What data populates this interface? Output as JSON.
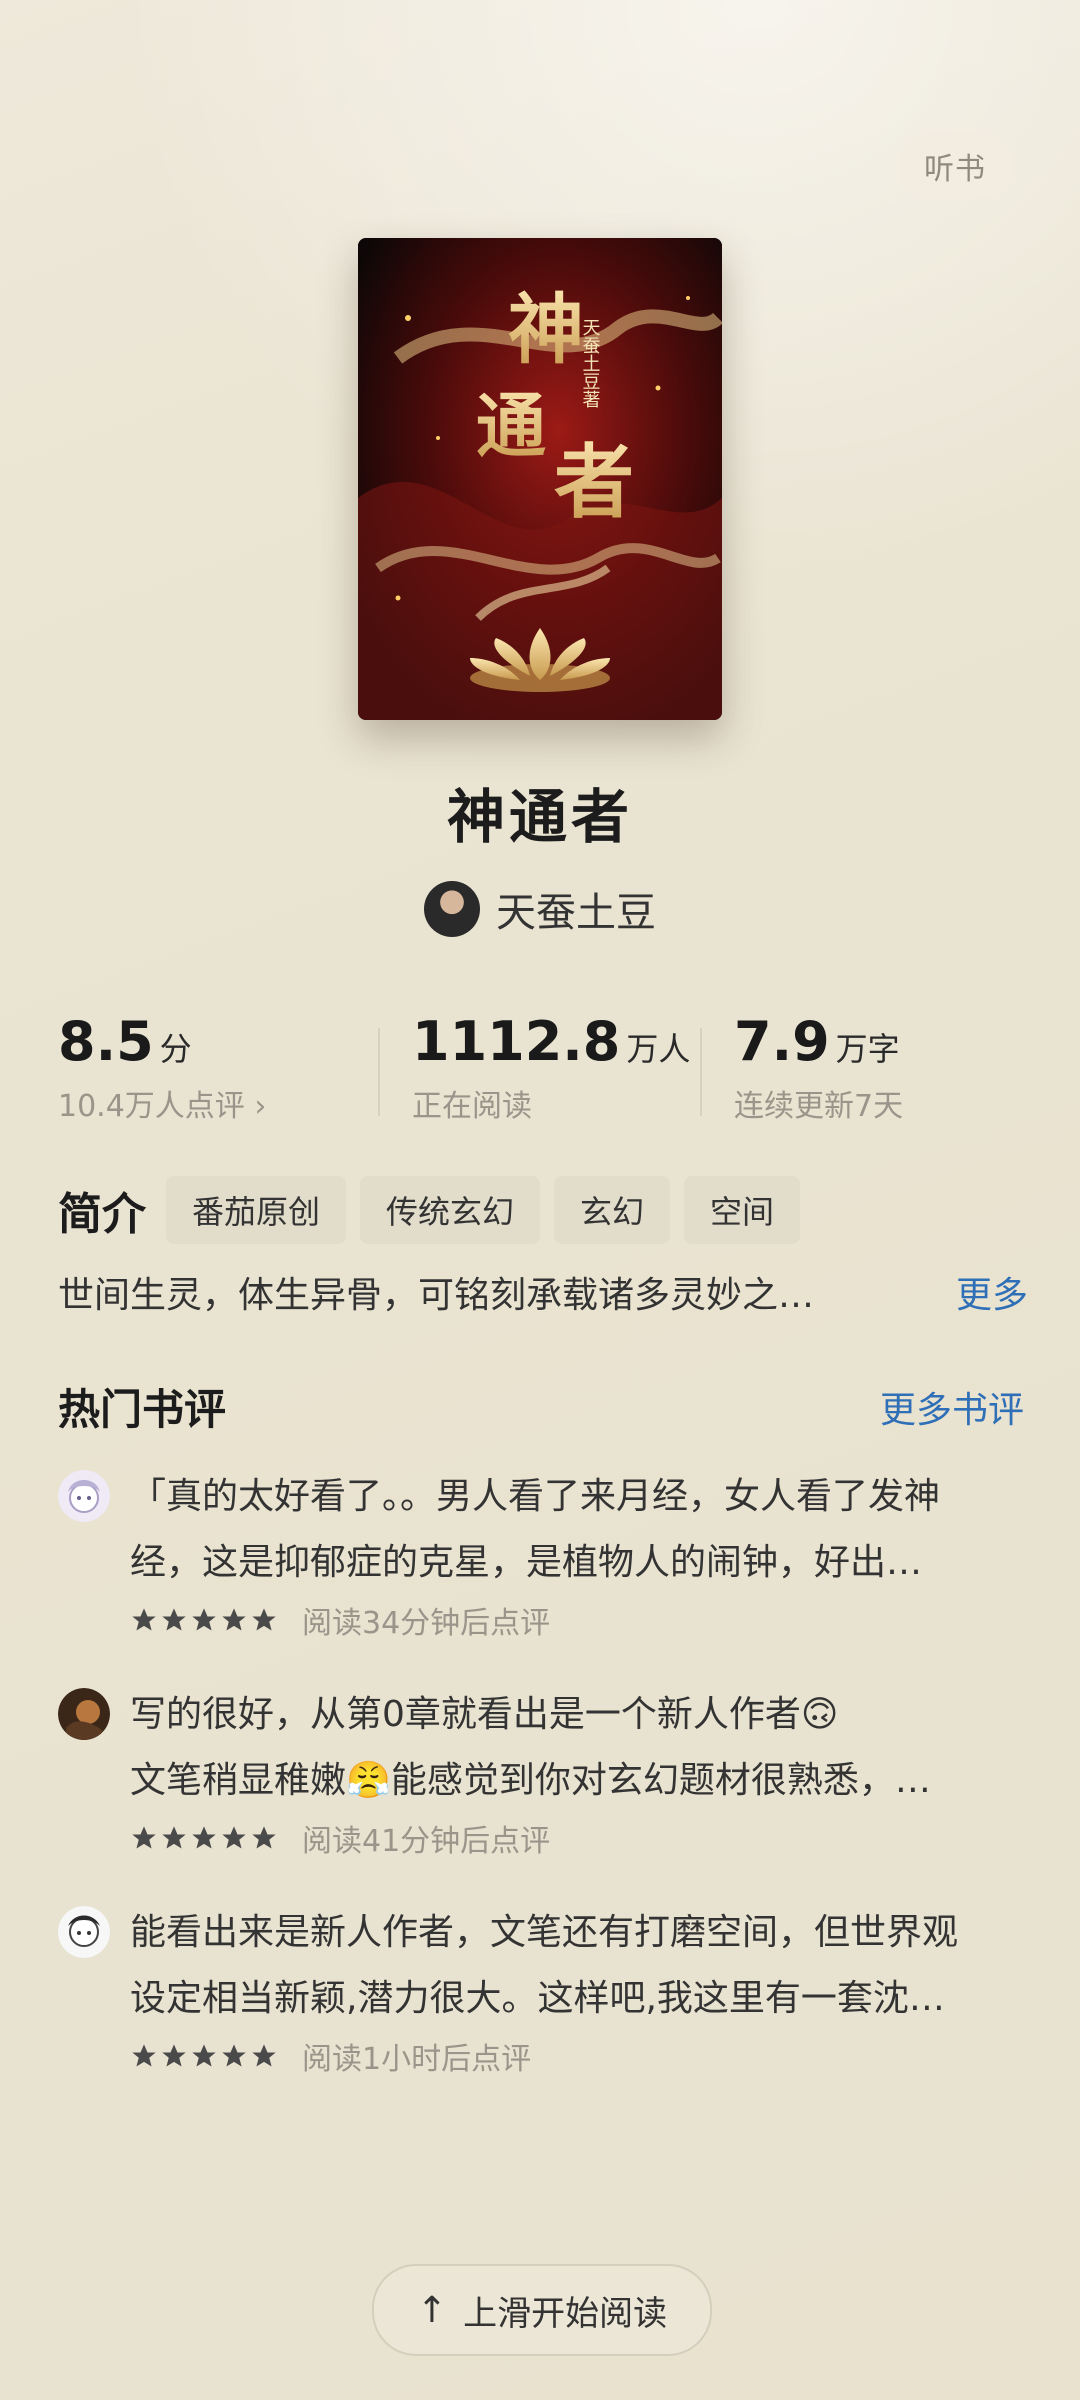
{
  "header": {
    "listen_label": "听书"
  },
  "cover": {
    "title_chars": [
      "神",
      "通",
      "者"
    ],
    "author_seal": "天蚕土豆著"
  },
  "book": {
    "title": "神通者",
    "author": "天蚕土豆"
  },
  "stats": {
    "rating_value": "8.5",
    "rating_unit": "分",
    "rating_sub": "10.4万人点评 ›",
    "readers_value": "1112.8",
    "readers_unit": "万人",
    "readers_sub": "正在阅读",
    "words_value": "7.9",
    "words_unit": "万字",
    "words_sub": "连续更新7天"
  },
  "intro": {
    "label": "简介",
    "tags": [
      "番茄原创",
      "传统玄幻",
      "玄幻",
      "空间"
    ],
    "synopsis": "世间生灵，体生异骨，可铭刻承载诸多灵妙之…",
    "more": "更多"
  },
  "reviews": {
    "title": "热门书评",
    "more": "更多书评",
    "items": [
      {
        "line1": "「真的太好看了。。男人看了来月经，女人看了发神",
        "line2": "经，这是抑郁症的克星，是植物人的闹钟，好出…",
        "stars": 5,
        "meta": "阅读34分钟后点评"
      },
      {
        "line1": "写的很好，从第0章就看出是一个新人作者🙃",
        "line2": "文笔稍显稚嫩😤能感觉到你对玄幻题材很熟悉，…",
        "stars": 5,
        "meta": "阅读41分钟后点评"
      },
      {
        "line1": "能看出来是新人作者，文笔还有打磨空间，但世界观",
        "line2": "设定相当新颖,潜力很大。这样吧,我这里有一套沈…",
        "stars": 5,
        "meta": "阅读1小时后点评"
      }
    ]
  },
  "footer": {
    "start_reading": "上滑开始阅读"
  },
  "colors": {
    "accent_link": "#2f6fb7",
    "background": "#e9e3d1"
  }
}
